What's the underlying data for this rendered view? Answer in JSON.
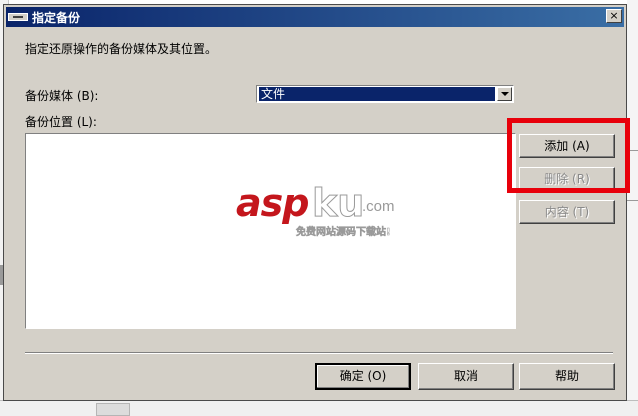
{
  "dialog": {
    "title": "指定备份",
    "close_glyph": "×",
    "instruction": "指定还原操作的备份媒体及其位置。",
    "media_label": "备份媒体 (B):",
    "media_value": "文件",
    "location_label": "备份位置 (L):"
  },
  "side_buttons": {
    "add": "添加 (A)",
    "delete": "删除 (R)",
    "contents": "内容 (T)"
  },
  "footer_buttons": {
    "ok": "确定 (O)",
    "cancel": "取消",
    "help": "帮助"
  },
  "watermark": {
    "brand_red": "asp",
    "brand_gray": "ku",
    "domain": ".com",
    "tagline": "免费网站源码下载站!"
  },
  "colors": {
    "highlight": "#e8000b",
    "titlebar": "#0a246a",
    "dialog_bg": "#d4d0c8"
  }
}
